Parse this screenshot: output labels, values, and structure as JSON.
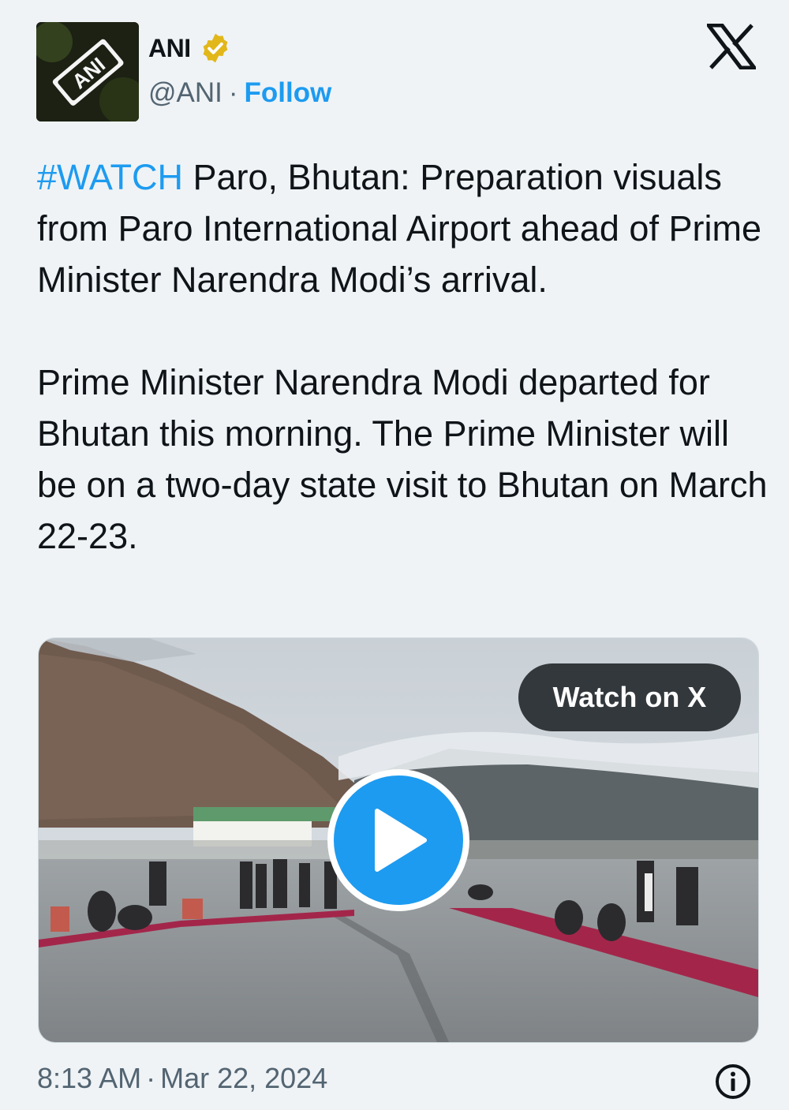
{
  "author": {
    "name": "ANI",
    "handle": "@ANI",
    "separator": "·",
    "follow_label": "Follow",
    "avatar_text": "ANI"
  },
  "tweet": {
    "hashtag": "#WATCH",
    "paragraph1": " Paro, Bhutan: Preparation visuals from Paro International Airport ahead of Prime Minister Narendra Modi’s arrival.",
    "paragraph2": "Prime Minister Narendra Modi departed for Bhutan this morning. The Prime Minister will be on a two-day state visit to Bhutan on March 22-23."
  },
  "media": {
    "watch_label": "Watch on X"
  },
  "footer": {
    "time": "8:13 AM",
    "separator": "·",
    "date": "Mar 22, 2024"
  },
  "icons": {
    "verified": "verified-badge-icon",
    "logo": "x-logo-icon",
    "play": "play-icon",
    "info": "info-icon"
  },
  "colors": {
    "accent": "#1d9bf0",
    "verified_gold": "#e2b719",
    "text": "#0f1419",
    "muted": "#536471",
    "carpet": "#a3264a"
  }
}
